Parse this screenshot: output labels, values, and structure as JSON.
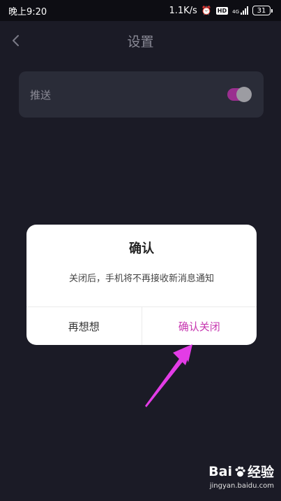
{
  "status_bar": {
    "time": "晚上9:20",
    "network_speed": "1.1K/s",
    "alarm_icon": "alarm-clock-icon",
    "hd_label": "HD",
    "network_type": "4G",
    "battery": "31"
  },
  "header": {
    "back_icon": "chevron-left-icon",
    "title": "设置"
  },
  "settings": {
    "push_label": "推送",
    "push_enabled": true,
    "toggle_color": "#9a2f8f"
  },
  "dialog": {
    "title": "确认",
    "message": "关闭后，手机将不再接收新消息通知",
    "cancel_label": "再想想",
    "confirm_label": "确认关闭",
    "confirm_color": "#c737b0"
  },
  "annotation": {
    "arrow_color": "#e33ce6"
  },
  "watermark": {
    "logo_left": "Bai",
    "logo_right": "经验",
    "url": "jingyan.baidu.com"
  }
}
